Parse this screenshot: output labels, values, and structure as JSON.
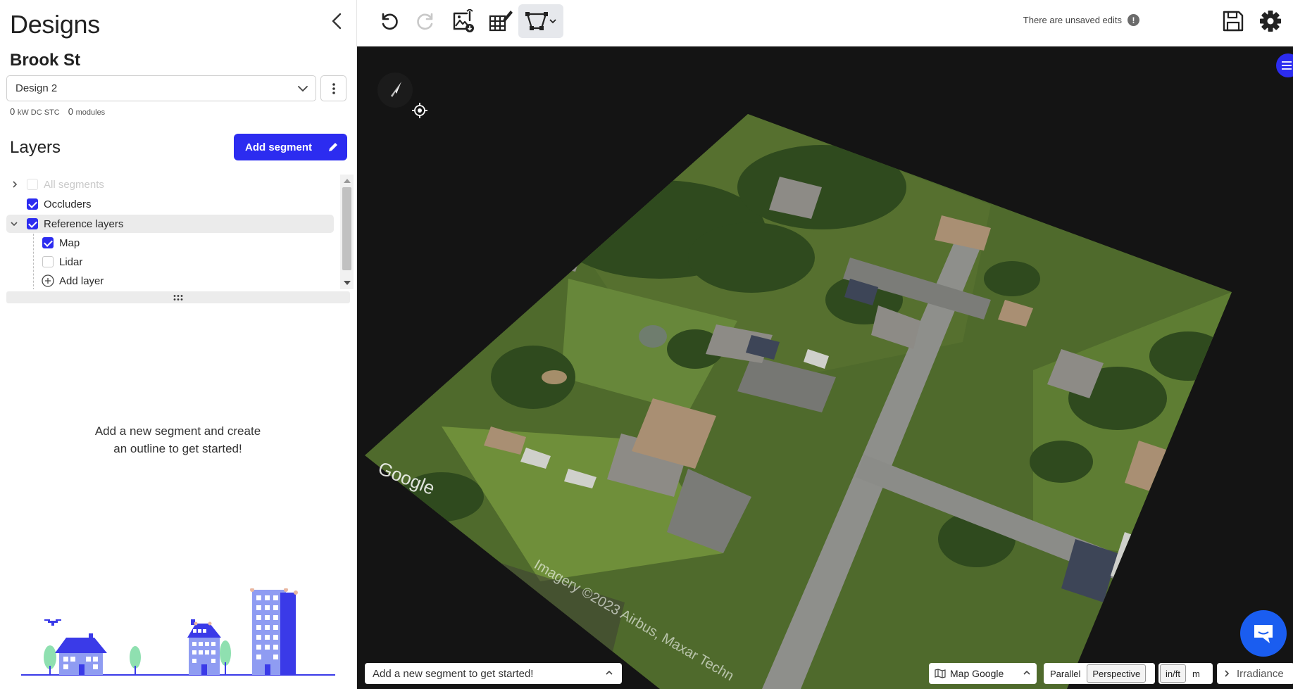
{
  "sidebar": {
    "title": "Designs",
    "project_name": "Brook St",
    "design_select": {
      "value": "Design 2"
    },
    "stats": {
      "kw_value": "0",
      "kw_unit": "kW DC STC",
      "modules_value": "0",
      "modules_unit": "modules"
    },
    "layers_title": "Layers",
    "add_segment_label": "Add segment",
    "tree": [
      {
        "label": "All segments",
        "checked": false,
        "disabled": true
      },
      {
        "label": "Occluders",
        "checked": true
      },
      {
        "label": "Reference layers",
        "checked": true,
        "expanded": true,
        "selected": true
      },
      {
        "label": "Map",
        "checked": true
      },
      {
        "label": "Lidar",
        "checked": false
      },
      {
        "label": "Add layer"
      }
    ],
    "empty_message": "Add a new segment and create an outline to get started!"
  },
  "toolbar": {
    "icons": [
      "undo-icon",
      "redo-icon",
      "image-download-icon",
      "grid-edit-icon",
      "segment-draw-icon"
    ],
    "unsaved_text": "There are unsaved edits",
    "unsaved_icon": "exclamation-icon",
    "save_icon": "save-icon",
    "settings_icon": "gear-icon"
  },
  "map": {
    "watermark_brand": "Google",
    "attribution": "Imagery ©2023 Airbus, Maxar Techn",
    "status_text": "Add a new segment to get started!",
    "map_source_label": "Map Google",
    "projection_options": [
      "Parallel",
      "Perspective"
    ],
    "projection_selected": "Perspective",
    "unit_options": [
      "in/ft",
      "m"
    ],
    "unit_selected": "in/ft",
    "irradiance_label": "Irradiance"
  },
  "colors": {
    "accent": "#2c2cf0",
    "chat": "#1a5df0",
    "map_bg": "#141414"
  }
}
